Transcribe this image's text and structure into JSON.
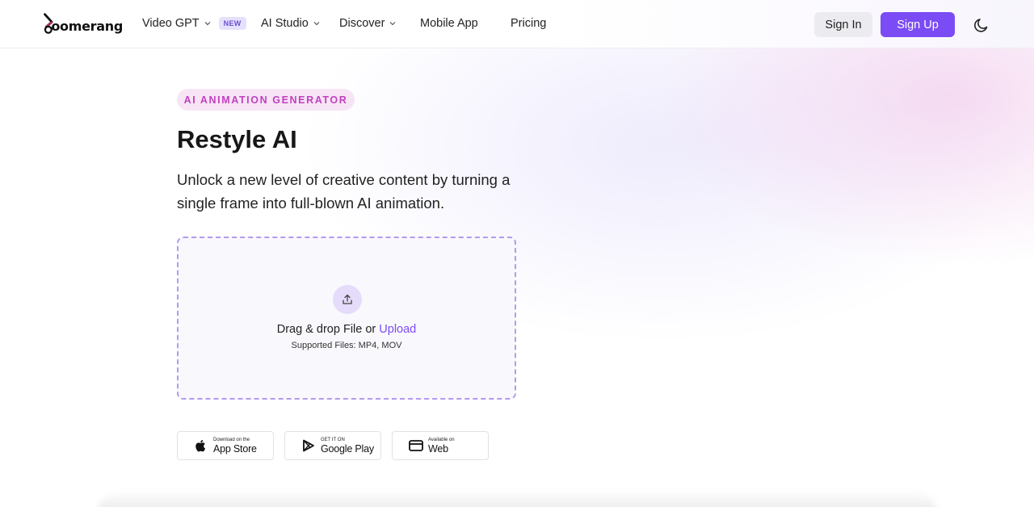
{
  "header": {
    "logo_text": "oomerang",
    "nav": [
      {
        "label": "Video GPT",
        "badge": "NEW",
        "dropdown": true
      },
      {
        "label": "AI Studio",
        "dropdown": true
      },
      {
        "label": "Discover",
        "dropdown": true
      },
      {
        "label": "Mobile App",
        "dropdown": false
      },
      {
        "label": "Pricing",
        "dropdown": false
      }
    ],
    "sign_in": "Sign In",
    "sign_up": "Sign Up",
    "theme_icon": "moon-icon"
  },
  "hero": {
    "tag": "AI ANIMATION GENERATOR",
    "title": "Restyle AI",
    "subtitle": "Unlock a new level of creative content by turning a single frame into full-blown AI animation."
  },
  "dropzone": {
    "prompt": "Drag & drop File or ",
    "upload_link": "Upload",
    "supported": "Supported Files: MP4, MOV",
    "icon": "upload-icon"
  },
  "stores": [
    {
      "small": "Download on the",
      "big": "App Store",
      "icon": "apple-icon"
    },
    {
      "small": "GET IT ON",
      "big": "Google Play",
      "icon": "google-play-icon"
    },
    {
      "small": "Available on",
      "big": "Web",
      "icon": "browser-icon"
    }
  ],
  "colors": {
    "accent": "#7b4bf5",
    "tag_text": "#c23fc0",
    "tag_bg": "#f7e5f6"
  }
}
